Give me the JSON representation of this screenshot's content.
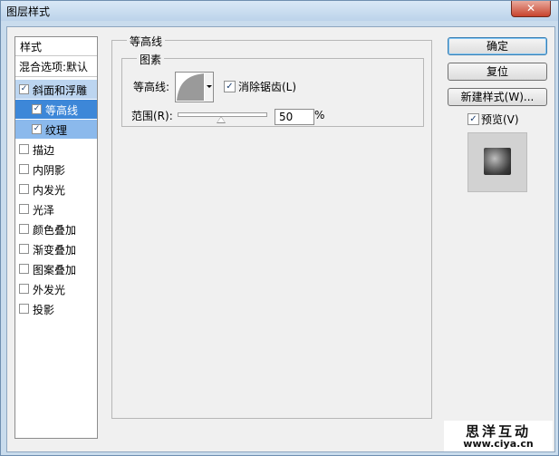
{
  "window": {
    "title": "图层样式",
    "close_glyph": "✕"
  },
  "styles_list": {
    "header": "样式",
    "blend_options": "混合选项:默认",
    "items": [
      {
        "label": "斜面和浮雕",
        "checked": true
      },
      {
        "label": "等高线",
        "checked": true
      },
      {
        "label": "纹理",
        "checked": true
      },
      {
        "label": "描边",
        "checked": false
      },
      {
        "label": "内阴影",
        "checked": false
      },
      {
        "label": "内发光",
        "checked": false
      },
      {
        "label": "光泽",
        "checked": false
      },
      {
        "label": "颜色叠加",
        "checked": false
      },
      {
        "label": "渐变叠加",
        "checked": false
      },
      {
        "label": "图案叠加",
        "checked": false
      },
      {
        "label": "外发光",
        "checked": false
      },
      {
        "label": "投影",
        "checked": false
      }
    ]
  },
  "panel": {
    "title": "等高线",
    "group_title": "图素",
    "contour_label": "等高线:",
    "anti_alias_label": "消除锯齿(L)",
    "anti_alias_checked": true,
    "range_label": "范围(R):",
    "range_value": "50",
    "range_unit": "%"
  },
  "buttons": {
    "ok": "确定",
    "reset": "复位",
    "new_style": "新建样式(W)..."
  },
  "preview": {
    "label": "预览(V)",
    "checked": true
  },
  "watermark": {
    "line1": "思洋互动",
    "line2": "www.ciya.cn"
  },
  "check_glyph": "✓"
}
